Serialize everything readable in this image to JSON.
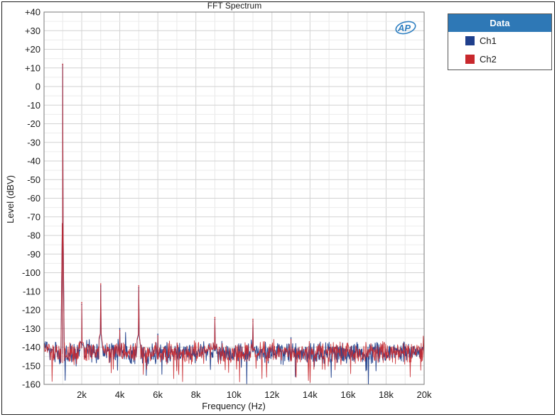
{
  "chart_data": {
    "type": "line",
    "title": "FFT Spectrum",
    "xlabel": "Frequency (Hz)",
    "ylabel": "Level (dBV)",
    "xlim": [
      20,
      20000
    ],
    "ylim": [
      -160,
      40
    ],
    "x_ticks": [
      {
        "value": 2000,
        "label": "2k"
      },
      {
        "value": 4000,
        "label": "4k"
      },
      {
        "value": 6000,
        "label": "6k"
      },
      {
        "value": 8000,
        "label": "8k"
      },
      {
        "value": 10000,
        "label": "10k"
      },
      {
        "value": 12000,
        "label": "12k"
      },
      {
        "value": 14000,
        "label": "14k"
      },
      {
        "value": 16000,
        "label": "16k"
      },
      {
        "value": 18000,
        "label": "18k"
      },
      {
        "value": 20000,
        "label": "20k"
      }
    ],
    "y_ticks": [
      {
        "value": 40,
        "label": "+40"
      },
      {
        "value": 30,
        "label": "+30"
      },
      {
        "value": 20,
        "label": "+20"
      },
      {
        "value": 10,
        "label": "+10"
      },
      {
        "value": 0,
        "label": "0"
      },
      {
        "value": -10,
        "label": "-10"
      },
      {
        "value": -20,
        "label": "-20"
      },
      {
        "value": -30,
        "label": "-30"
      },
      {
        "value": -40,
        "label": "-40"
      },
      {
        "value": -50,
        "label": "-50"
      },
      {
        "value": -60,
        "label": "-60"
      },
      {
        "value": -70,
        "label": "-70"
      },
      {
        "value": -80,
        "label": "-80"
      },
      {
        "value": -90,
        "label": "-90"
      },
      {
        "value": -100,
        "label": "-100"
      },
      {
        "value": -110,
        "label": "-110"
      },
      {
        "value": -120,
        "label": "-120"
      },
      {
        "value": -130,
        "label": "-130"
      },
      {
        "value": -140,
        "label": "-140"
      },
      {
        "value": -150,
        "label": "-150"
      },
      {
        "value": -160,
        "label": "-160"
      }
    ],
    "grid": true,
    "legend_position": "right",
    "noise_floor_dBV": -143,
    "series": [
      {
        "name": "Ch1",
        "color": "#1f3f8c",
        "peaks": [
          {
            "x": 1000,
            "y": 12
          },
          {
            "x": 2000,
            "y": -117
          },
          {
            "x": 3000,
            "y": -107
          },
          {
            "x": 4000,
            "y": -130
          },
          {
            "x": 5000,
            "y": -108
          },
          {
            "x": 6000,
            "y": -133
          },
          {
            "x": 9000,
            "y": -125
          },
          {
            "x": 11000,
            "y": -126
          },
          {
            "x": 13000,
            "y": -135
          }
        ]
      },
      {
        "name": "Ch2",
        "color": "#c8282d",
        "peaks": [
          {
            "x": 1000,
            "y": 12
          },
          {
            "x": 2000,
            "y": -116
          },
          {
            "x": 3000,
            "y": -106
          },
          {
            "x": 4000,
            "y": -131
          },
          {
            "x": 5000,
            "y": -107
          },
          {
            "x": 6000,
            "y": -134
          },
          {
            "x": 9000,
            "y": -124
          },
          {
            "x": 11000,
            "y": -125
          },
          {
            "x": 13000,
            "y": -136
          }
        ]
      }
    ]
  },
  "legend": {
    "header": "Data",
    "items": [
      {
        "label": "Ch1",
        "color": "#1f3f8c"
      },
      {
        "label": "Ch2",
        "color": "#c8282d"
      }
    ]
  },
  "logo": {
    "text": "AP",
    "color": "#2e7fc1"
  }
}
